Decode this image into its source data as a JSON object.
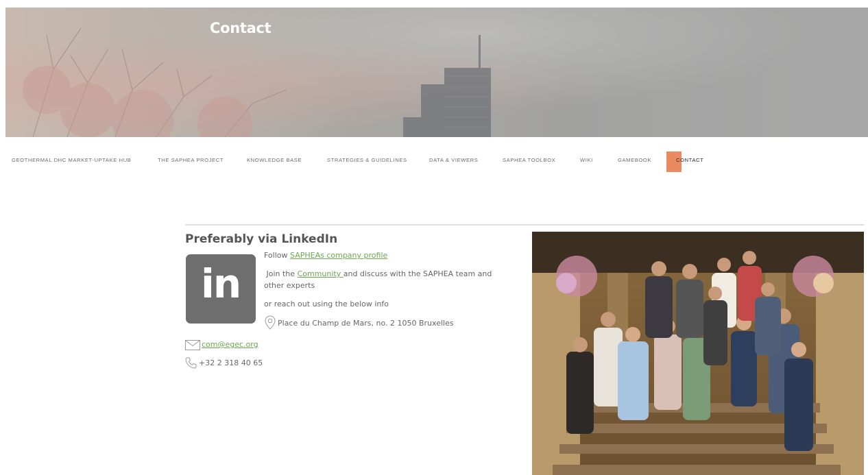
{
  "hero": {
    "title": "Contact"
  },
  "nav": {
    "items": [
      "GEOTHERMAL DHC MARKET-UPTAKE HUB",
      "THE SAPHEA PROJECT",
      "KNOWLEDGE BASE",
      "STRATEGIES & GUIDELINES",
      "DATA & VIEWERS",
      "SAPHEA TOOLBOX",
      "WIKI",
      "GAMEBOOK",
      "CONTACT"
    ],
    "active": "CONTACT",
    "active_color": "#e98a61"
  },
  "main": {
    "heading": "Preferably via LinkedIn",
    "logo_text": "in",
    "follow_prefix": "Follow ",
    "follow_link": "SAPHEAs company profile",
    "join_prefix": "Join the ",
    "join_link": "Community ",
    "join_suffix_1": "and discuss with the SAPHEA team and",
    "join_suffix_2": "other experts",
    "reach_out": "or reach out using the below info",
    "address": "Place du Champ de Mars, no. 2 1050 Bruxelles",
    "email": "com@egec.org",
    "phone": "+32 2 318 40 65"
  },
  "colors": {
    "link": "#6aa84f",
    "logo_bg": "#6e6e6e"
  },
  "icons": [
    "location-pin-icon",
    "mail-icon",
    "phone-icon"
  ]
}
